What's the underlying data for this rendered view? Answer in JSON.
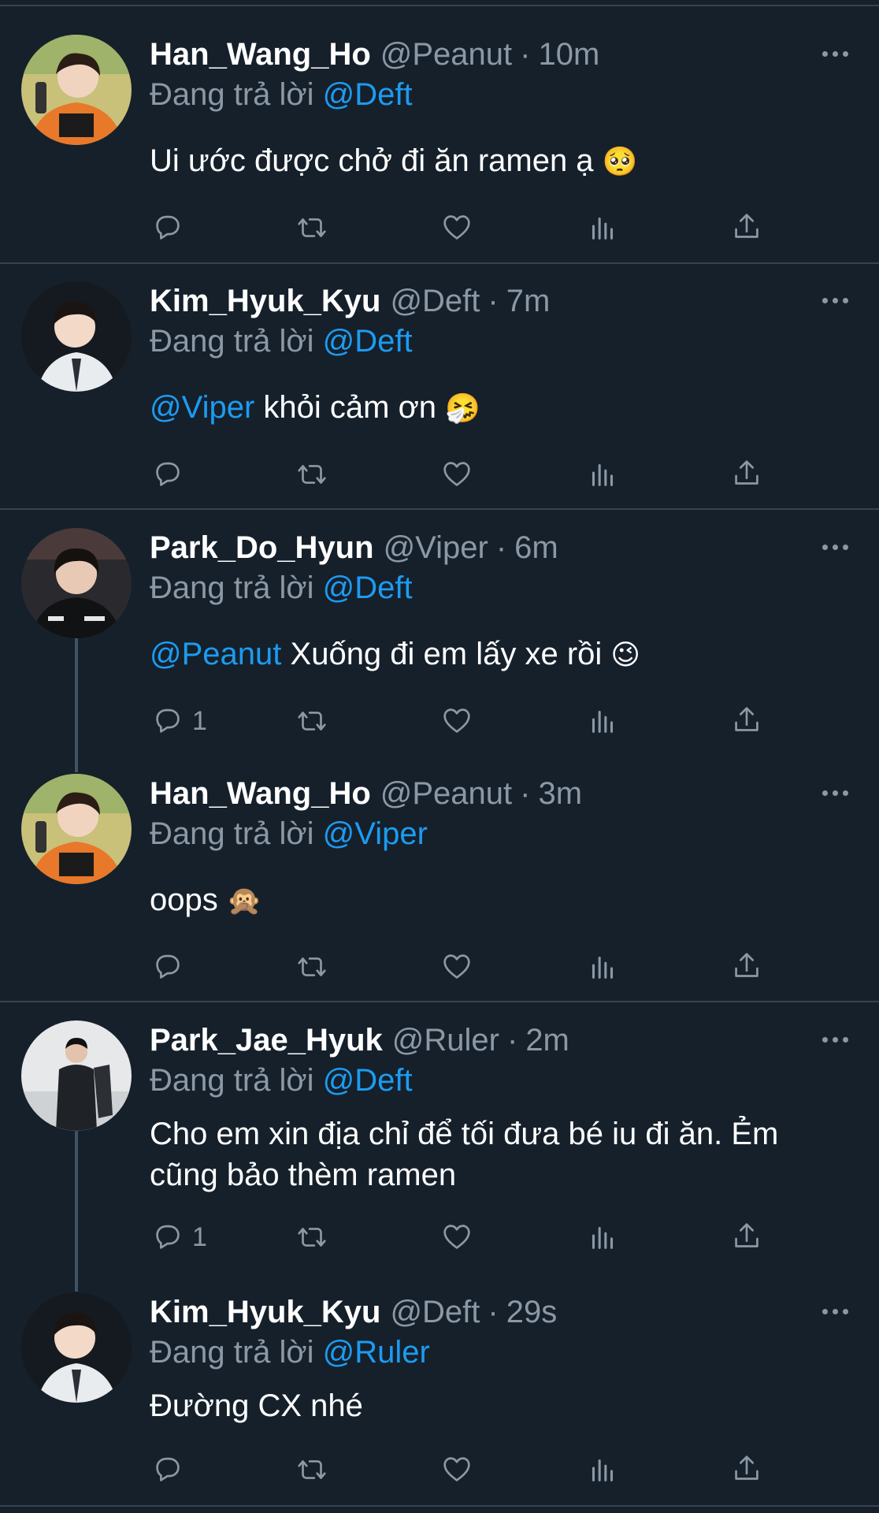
{
  "tweets": [
    {
      "name": "Han_Wang_Ho",
      "handle": "@Peanut",
      "time": "10m",
      "reply_prefix": "Đang trả lời",
      "reply_to": "@Deft",
      "mention": "",
      "text": "Ui ước được chở đi ăn ramen ạ",
      "emoji": "🥺",
      "avatar": "peanut-avatar",
      "reply_count": ""
    },
    {
      "name": "Kim_Hyuk_Kyu",
      "handle": "@Deft",
      "time": "7m",
      "reply_prefix": "Đang trả lời",
      "reply_to": "@Deft",
      "mention": "@Viper",
      "text": "khỏi cảm ơn",
      "emoji": "🤧",
      "avatar": "deft-avatar",
      "reply_count": ""
    },
    {
      "name": "Park_Do_Hyun",
      "handle": "@Viper",
      "time": "6m",
      "reply_prefix": "Đang trả lời",
      "reply_to": "@Deft",
      "mention": "@Peanut",
      "text": "Xuống đi em lấy xe rồi",
      "emoji": "😉",
      "avatar": "viper-avatar",
      "reply_count": "1"
    },
    {
      "name": "Han_Wang_Ho",
      "handle": "@Peanut",
      "time": "3m",
      "reply_prefix": "Đang trả lời",
      "reply_to": "@Viper",
      "mention": "",
      "text": "oops",
      "emoji": "🙊",
      "avatar": "peanut-avatar",
      "reply_count": ""
    },
    {
      "name": "Park_Jae_Hyuk",
      "handle": "@Ruler",
      "time": "2m",
      "reply_prefix": "Đang trả lời",
      "reply_to": "@Deft",
      "mention": "",
      "text_line1": "Cho em xin địa chỉ để tối đưa bé iu đi ăn. Ẻm",
      "text_line2": "cũng bảo thèm ramen",
      "emoji": "",
      "avatar": "ruler-avatar",
      "reply_count": "1"
    },
    {
      "name": "Kim_Hyuk_Kyu",
      "handle": "@Deft",
      "time": "29s",
      "reply_prefix": "Đang trả lời",
      "reply_to": "@Ruler",
      "mention": "",
      "text": "Đường CX nhé",
      "emoji": "",
      "avatar": "deft-avatar",
      "reply_count": ""
    }
  ],
  "separator": "·",
  "colors": {
    "background": "#15202b",
    "text": "#ffffff",
    "muted": "#8b98a5",
    "link": "#1d9bf0",
    "divider": "#38444d"
  },
  "action_icons": [
    "reply-icon",
    "retweet-icon",
    "like-icon",
    "analytics-icon",
    "share-icon"
  ]
}
